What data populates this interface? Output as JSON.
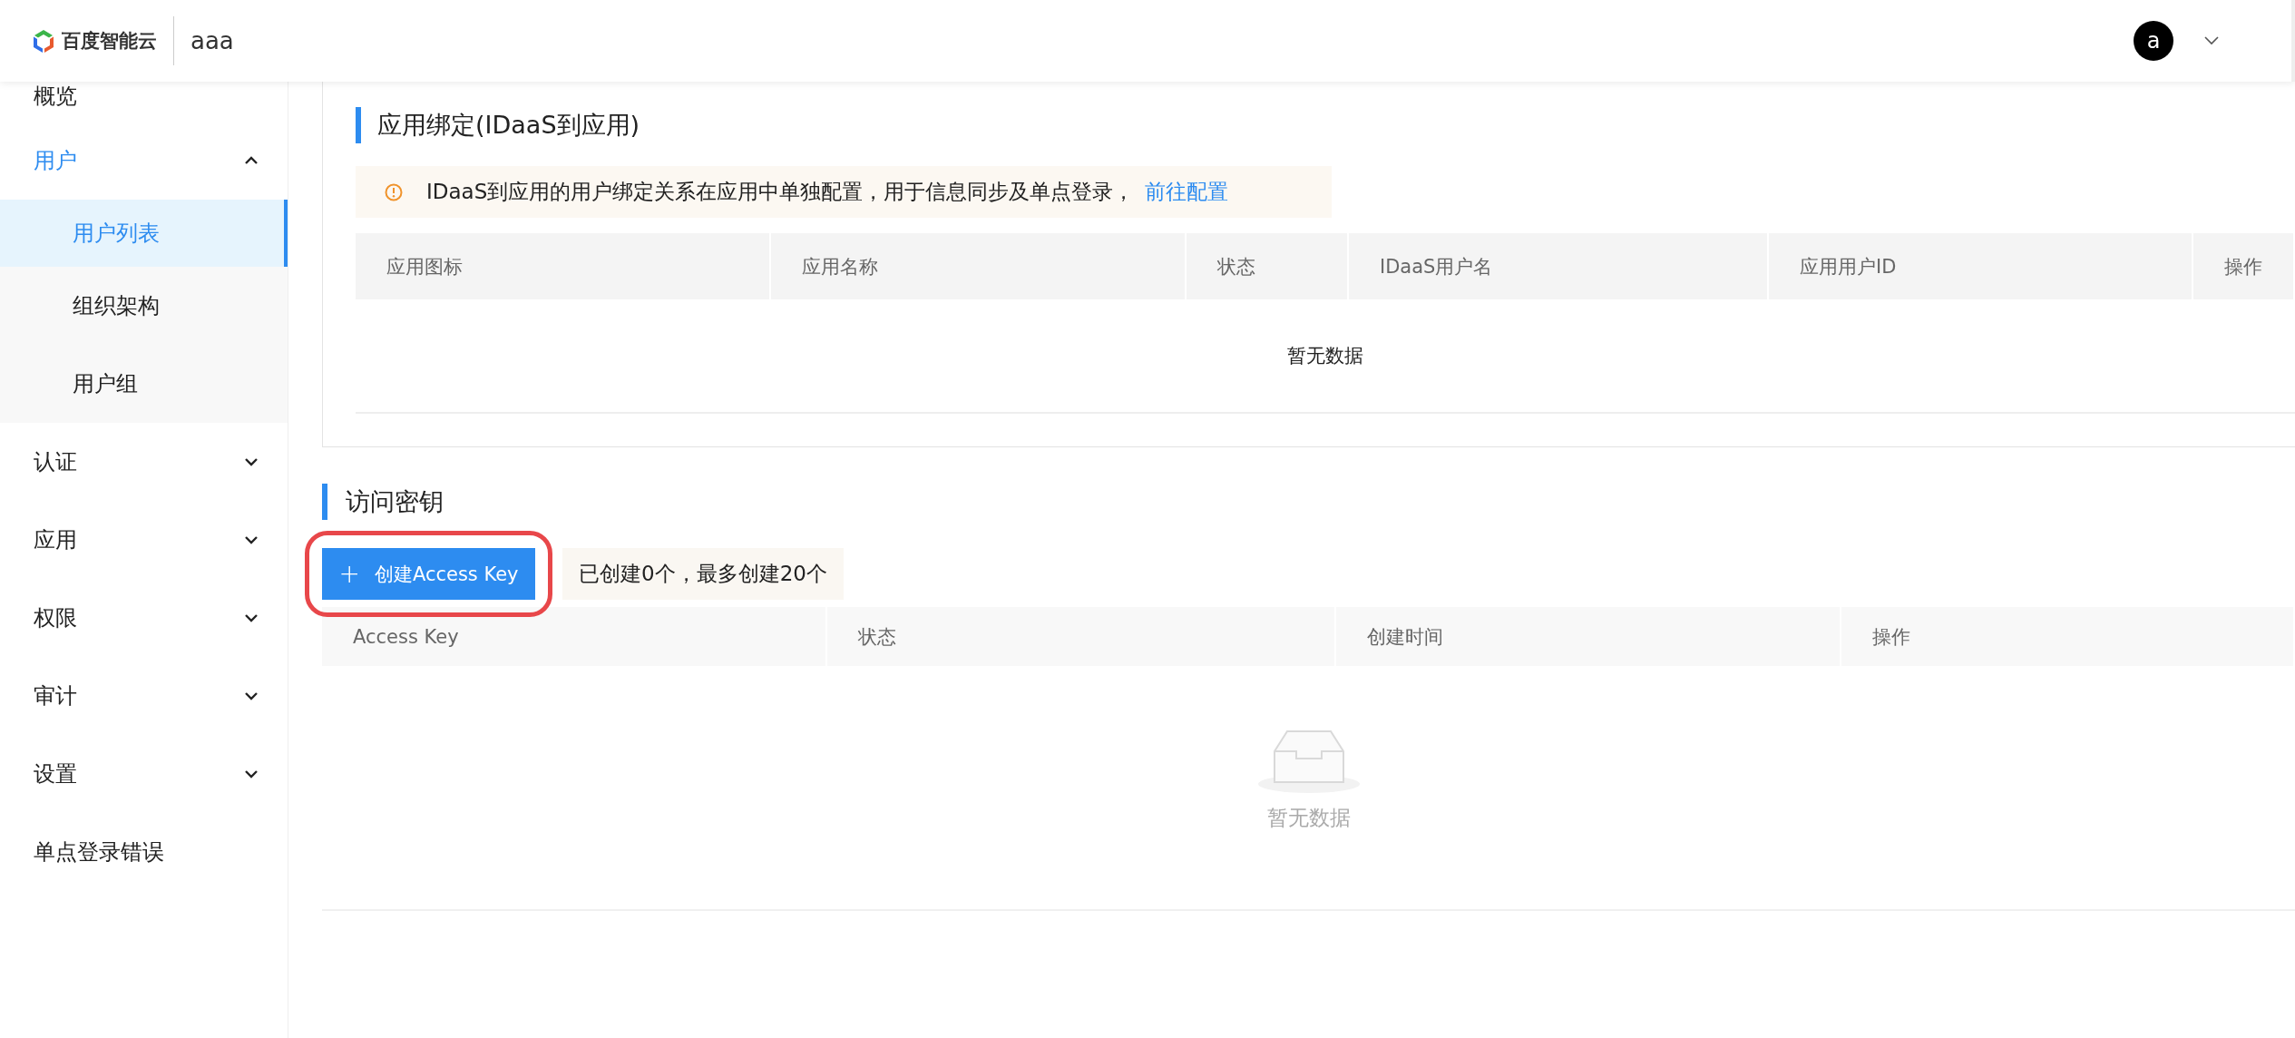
{
  "header": {
    "brand": "百度智能云",
    "workspace": "aaa",
    "avatar": "a"
  },
  "sidebar": {
    "items": [
      {
        "kind": "link",
        "label": "概览",
        "selected": false
      },
      {
        "kind": "group",
        "label": "用户",
        "expanded": true,
        "children": [
          {
            "label": "用户列表",
            "selected": true
          },
          {
            "label": "组织架构",
            "selected": false
          },
          {
            "label": "用户组",
            "selected": false
          }
        ]
      },
      {
        "kind": "group",
        "label": "认证",
        "expanded": false
      },
      {
        "kind": "group",
        "label": "应用",
        "expanded": false
      },
      {
        "kind": "group",
        "label": "权限",
        "expanded": false
      },
      {
        "kind": "group",
        "label": "审计",
        "expanded": false
      },
      {
        "kind": "group",
        "label": "设置",
        "expanded": false
      },
      {
        "kind": "link",
        "label": "单点登录错误",
        "selected": false
      }
    ]
  },
  "app_binding": {
    "title": "应用绑定(IDaaS到应用)",
    "alert": {
      "text": "IDaaS到应用的用户绑定关系在应用中单独配置，用于信息同步及单点登录，",
      "link": "前往配置"
    },
    "table": {
      "columns": [
        "应用图标",
        "应用名称",
        "状态",
        "IDaaS用户名",
        "应用用户ID",
        "操作"
      ],
      "empty_text": "暂无数据"
    }
  },
  "access_keys": {
    "title": "访问密钥",
    "create_button": {
      "icon": "+",
      "label": "创建Access Key",
      "highlighted": true
    },
    "quota_note": "已创建0个，最多创建20个",
    "table": {
      "columns": [
        "Access Key",
        "状态",
        "创建时间",
        "操作"
      ],
      "empty_text": "暂无数据"
    }
  }
}
